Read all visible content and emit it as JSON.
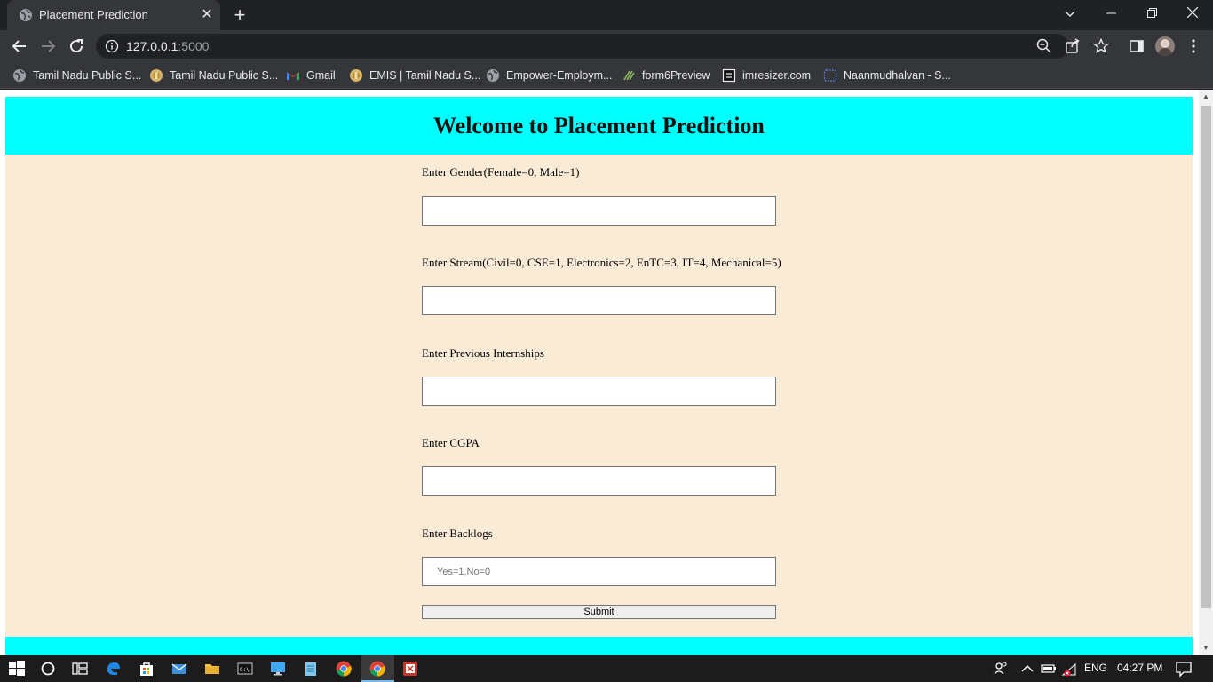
{
  "browser": {
    "tab_title": "Placement Prediction",
    "url_host": "127.0.0.1",
    "url_port": ":5000",
    "bookmarks": [
      {
        "label": "Tamil Nadu Public S...",
        "icon": "globe-icon"
      },
      {
        "label": "Tamil Nadu Public S...",
        "icon": "emblem-icon"
      },
      {
        "label": "Gmail",
        "icon": "gmail-icon"
      },
      {
        "label": "EMIS | Tamil Nadu S...",
        "icon": "emblem-icon"
      },
      {
        "label": "Empower-Employm...",
        "icon": "globe-icon"
      },
      {
        "label": "form6Preview",
        "icon": "form-icon"
      },
      {
        "label": "imresizer.com",
        "icon": "imresizer-icon"
      },
      {
        "label": "Naanmudhalvan - S...",
        "icon": "naan-icon"
      }
    ]
  },
  "page": {
    "heading": "Welcome to Placement Prediction",
    "fields": [
      {
        "label": "Enter Gender(Female=0, Male=1)",
        "value": "",
        "placeholder": ""
      },
      {
        "label": "Enter Stream(Civil=0, CSE=1, Electronics=2, EnTC=3, IT=4, Mechanical=5)",
        "value": "",
        "placeholder": ""
      },
      {
        "label": "Enter Previous Internships",
        "value": "",
        "placeholder": ""
      },
      {
        "label": "Enter CGPA",
        "value": "",
        "placeholder": ""
      },
      {
        "label": "Enter Backlogs",
        "value": "",
        "placeholder": "Yes=1,No=0"
      }
    ],
    "submit_label": "Submit",
    "colors": {
      "header": "#00ffff",
      "background": "#faebd7"
    }
  },
  "taskbar": {
    "language": "ENG",
    "time": "04:27 PM"
  }
}
